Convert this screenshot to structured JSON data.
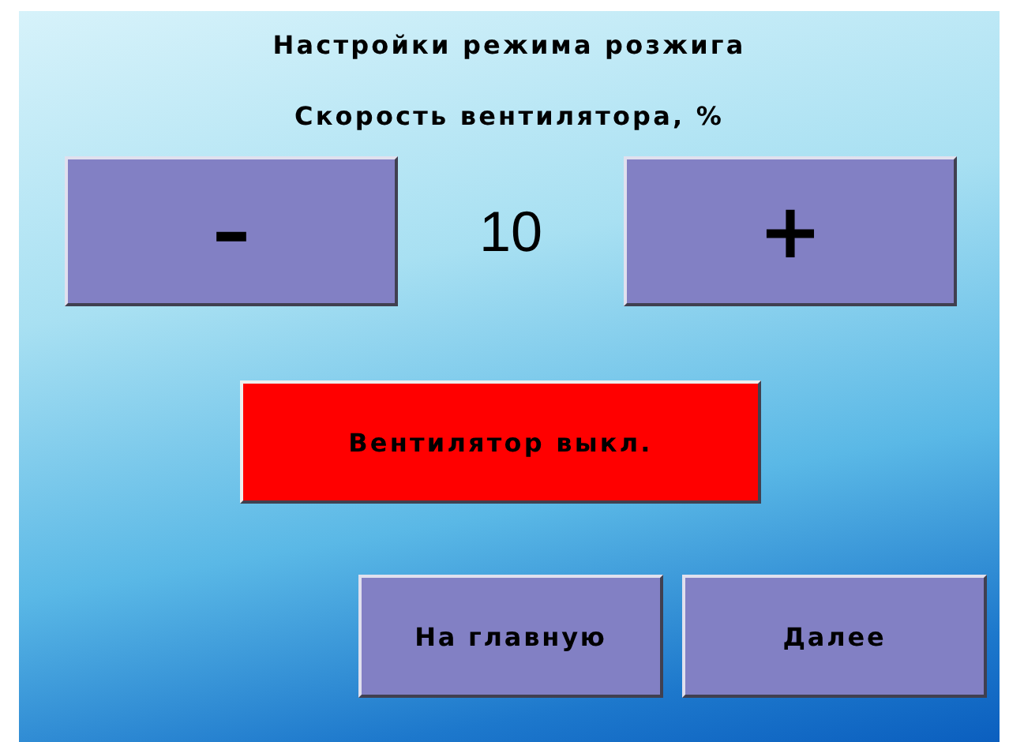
{
  "title": "Настройки режима розжига",
  "subtitle": "Скорость вентилятора, %",
  "speed": {
    "decrease": "–",
    "value": "10",
    "increase": "+"
  },
  "fan_button": {
    "label": "Вентилятор выкл.",
    "on": false
  },
  "buttons": [
    {
      "label": "На главную"
    },
    {
      "label": "Далее"
    }
  ]
}
